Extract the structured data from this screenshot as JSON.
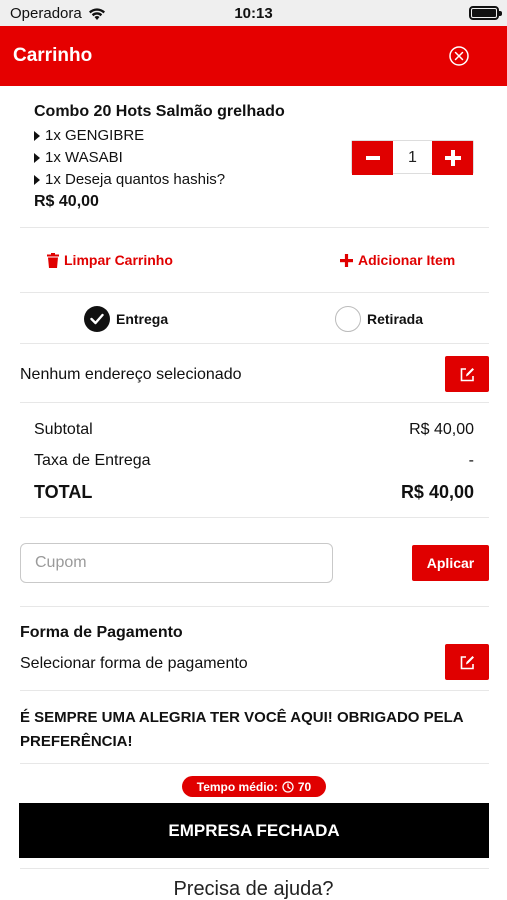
{
  "status_bar": {
    "carrier": "Operadora",
    "time": "10:13"
  },
  "header": {
    "title": "Carrinho"
  },
  "cart_item": {
    "name": "Combo 20 Hots Salmão grelhado",
    "options": [
      "1x GENGIBRE",
      "1x WASABI",
      "1x Deseja quantos hashis?"
    ],
    "price": "R$ 40,00",
    "quantity": "1"
  },
  "actions": {
    "clear_label": "Limpar Carrinho",
    "add_label": "Adicionar Item"
  },
  "delivery": {
    "delivery_label": "Entrega",
    "pickup_label": "Retirada",
    "selected": "Entrega"
  },
  "address": {
    "text": "Nenhum endereço selecionado"
  },
  "summary": {
    "subtotal_label": "Subtotal",
    "subtotal_value": "R$ 40,00",
    "fee_label": "Taxa de Entrega",
    "fee_value": "-",
    "total_label": "TOTAL",
    "total_value": "R$ 40,00"
  },
  "coupon": {
    "placeholder": "Cupom",
    "apply_label": "Aplicar"
  },
  "payment": {
    "title": "Forma de Pagamento",
    "select_label": "Selecionar forma de pagamento"
  },
  "welcome": {
    "message": "É SEMPRE UMA ALEGRIA TER VOCÊ AQUI! OBRIGADO PELA PREFERÊNCIA!"
  },
  "avg_time": {
    "label": "Tempo médio:",
    "value": "70"
  },
  "closed": {
    "label": "EMPRESA FECHADA"
  },
  "help": {
    "label": "Precisa de ajuda?"
  },
  "colors": {
    "brand": "#e50000",
    "closed_bg": "#000000"
  },
  "icons": [
    "wifi-icon",
    "battery-icon",
    "close-circle-icon",
    "minus-icon",
    "plus-icon",
    "trash-icon",
    "check-circle-icon",
    "edit-icon",
    "clock-icon"
  ]
}
